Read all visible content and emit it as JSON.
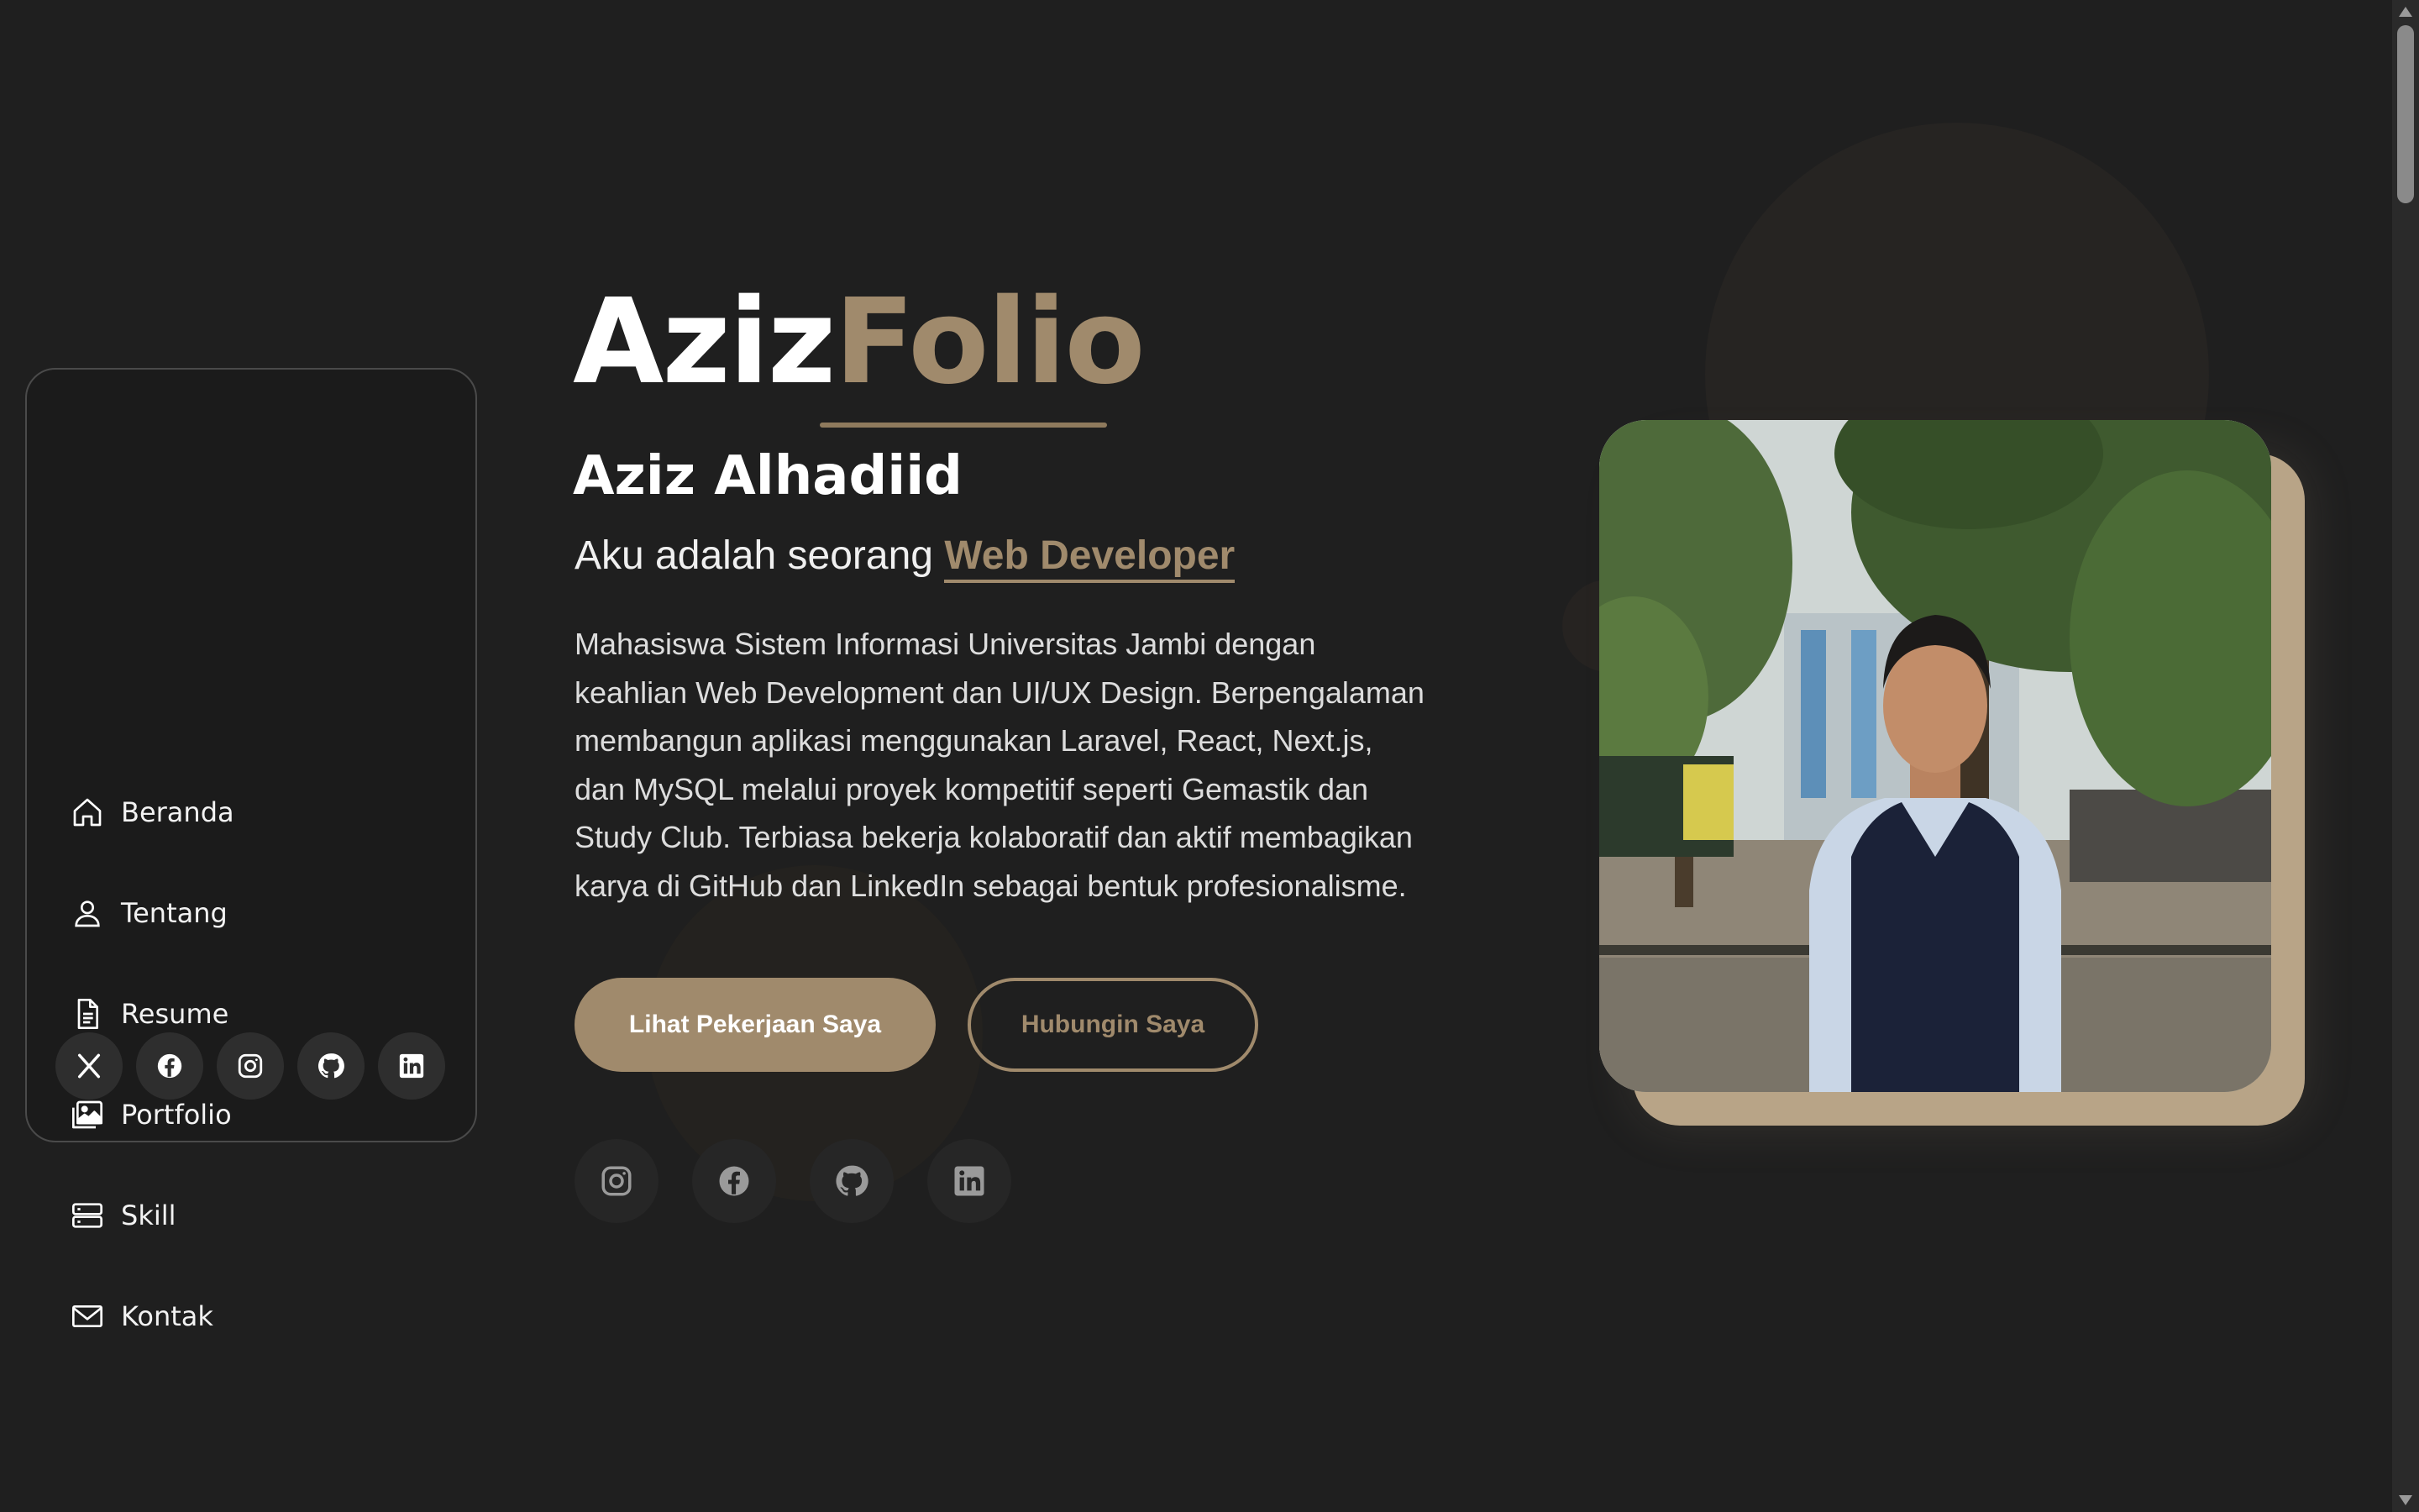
{
  "brand": {
    "part1": "Aziz",
    "part2": "Folio"
  },
  "hero": {
    "name": "Aziz Alhadiid",
    "tagline_prefix": "Aku adalah seorang ",
    "tagline_role": "Web Developer",
    "bio": "Mahasiswa Sistem Informasi Universitas Jambi dengan keahlian Web Development dan UI/UX Design. Berpengalaman membangun aplikasi menggunakan Laravel, React, Next.js, dan MySQL melalui proyek kompetitif seperti Gemastik dan Study Club. Terbiasa bekerja kolaboratif dan aktif membagikan karya di GitHub dan LinkedIn sebagai bentuk profesionalisme.",
    "primary_button": "Lihat Pekerjaan Saya",
    "secondary_button": "Hubungin Saya",
    "socials": [
      "instagram-icon",
      "facebook-icon",
      "github-icon",
      "linkedin-icon"
    ]
  },
  "sidebar": {
    "items": [
      {
        "label": "Beranda",
        "icon": "home-icon"
      },
      {
        "label": "Tentang",
        "icon": "user-icon"
      },
      {
        "label": "Resume",
        "icon": "document-icon"
      },
      {
        "label": "Portfolio",
        "icon": "image-icon"
      },
      {
        "label": "Skill",
        "icon": "server-icon"
      },
      {
        "label": "Kontak",
        "icon": "envelope-icon"
      }
    ],
    "socials": [
      "x-icon",
      "facebook-icon",
      "instagram-icon",
      "github-icon",
      "linkedin-icon"
    ]
  },
  "colors": {
    "background": "#1f1f1f",
    "accent": "#a08a6c",
    "photo_frame": "#b8a487",
    "sidebar_border": "#4a4a4a"
  }
}
